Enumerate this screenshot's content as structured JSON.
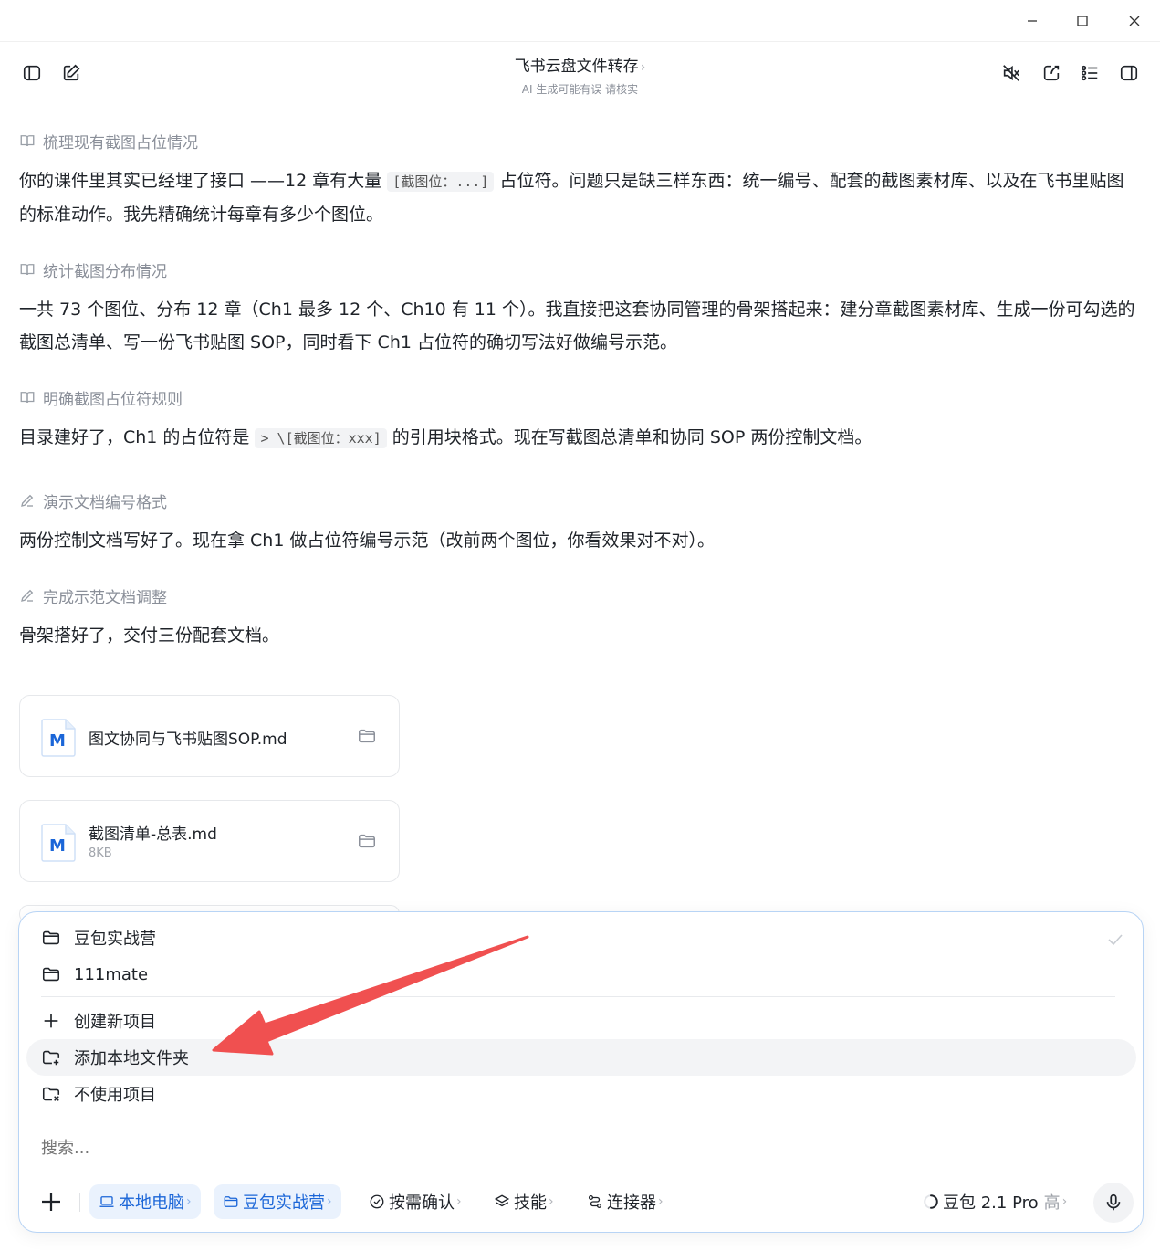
{
  "window": {
    "minimize": "minimize",
    "maximize": "maximize",
    "close": "close"
  },
  "header": {
    "title": "飞书云盘文件转存",
    "title_chevron": "›",
    "subtitle": "AI 生成可能有误 请核实"
  },
  "steps": [
    {
      "label": "梳理现有截图占位情况",
      "icon": "book-icon"
    },
    {
      "label": "统计截图分布情况",
      "icon": "book-icon"
    },
    {
      "label": "明确截图占位符规则",
      "icon": "book-icon"
    },
    {
      "label": "演示文档编号格式",
      "icon": "pencil-icon"
    },
    {
      "label": "完成示范文档调整",
      "icon": "pencil-icon"
    }
  ],
  "paragraphs": {
    "p1_a": "你的课件里其实已经埋了接口 ——12 章有大量 ",
    "p1_code": "[截图位：...]",
    "p1_b": " 占位符。问题只是缺三样东西：统一编号、配套的截图素材库、以及在飞书里贴图的标准动作。我先精确统计每章有多少个图位。",
    "p2": "一共 73 个图位、分布 12 章（Ch1 最多 12 个、Ch10 有 11 个）。我直接把这套协同管理的骨架搭起来：建分章截图素材库、生成一份可勾选的截图总清单、写一份飞书贴图 SOP，同时看下 Ch1 占位符的确切写法好做编号示范。",
    "p3_a": "目录建好了，Ch1 的占位符是 ",
    "p3_code": "> \\[截图位：xxx]",
    "p3_b": " 的引用块格式。现在写截图总清单和协同 SOP 两份控制文档。",
    "p4": "两份控制文档写好了。现在拿 Ch1 做占位符编号示范（改前两个图位，你看效果对不对）。",
    "p5": "骨架搭好了，交付三份配套文档。"
  },
  "files": [
    {
      "name": "图文协同与飞书贴图SOP.md",
      "size": ""
    },
    {
      "name": "截图清单-总表.md",
      "size": "8KB"
    }
  ],
  "project_menu": {
    "projects": [
      "豆包实战营",
      "111mate"
    ],
    "create": "创建新项目",
    "add_folder": "添加本地文件夹",
    "no_project": "不使用项目"
  },
  "search": {
    "placeholder": "搜索..."
  },
  "toolbar": {
    "local": "本地电脑",
    "project": "豆包实战营",
    "confirm": "按需确认",
    "skills": "技能",
    "connectors": "连接器",
    "model": "豆包 2.1 Pro",
    "model_level": "高",
    "chevron": "›"
  },
  "colors": {
    "accent": "#1b66d8",
    "arrow": "#f05050",
    "chip_bg": "#eaf2fd"
  }
}
